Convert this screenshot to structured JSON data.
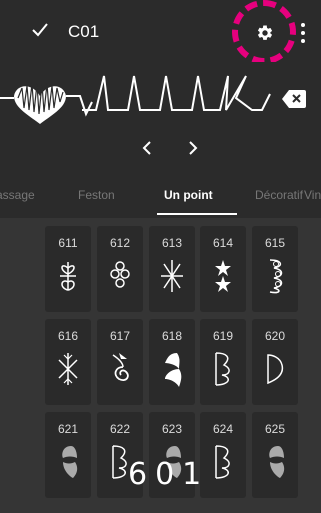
{
  "app": {
    "title": "C01"
  },
  "tabs": [
    {
      "label": "assage",
      "active": false
    },
    {
      "label": "Feston",
      "active": false
    },
    {
      "label": "Un point",
      "active": true
    },
    {
      "label": "Décoratif",
      "active": false
    },
    {
      "label": "Vin",
      "active": false
    }
  ],
  "stitches": [
    {
      "number": "611",
      "icon": "leaf-flower"
    },
    {
      "number": "612",
      "icon": "chain-flower"
    },
    {
      "number": "613",
      "icon": "starburst"
    },
    {
      "number": "614",
      "icon": "stars"
    },
    {
      "number": "615",
      "icon": "clusters"
    },
    {
      "number": "616",
      "icon": "snowflake"
    },
    {
      "number": "617",
      "icon": "spiral"
    },
    {
      "number": "618",
      "icon": "hearts"
    },
    {
      "number": "619",
      "icon": "heart-outline"
    },
    {
      "number": "620",
      "icon": "leaf-outline"
    },
    {
      "number": "621",
      "icon": "hearts-faded"
    },
    {
      "number": "622",
      "icon": "heart-outline"
    },
    {
      "number": "623",
      "icon": "hearts-faded"
    },
    {
      "number": "624",
      "icon": "heart-outline"
    },
    {
      "number": "625",
      "icon": "hearts-faded"
    }
  ],
  "selection": {
    "code": "601"
  },
  "colors": {
    "highlight_ring": "#e6007e",
    "background": "#202020",
    "tile": "#2a2a2a"
  },
  "icons": [
    "check-icon",
    "gear-icon",
    "more-vert-icon",
    "backspace-icon",
    "chevron-left-icon",
    "chevron-right-icon"
  ]
}
